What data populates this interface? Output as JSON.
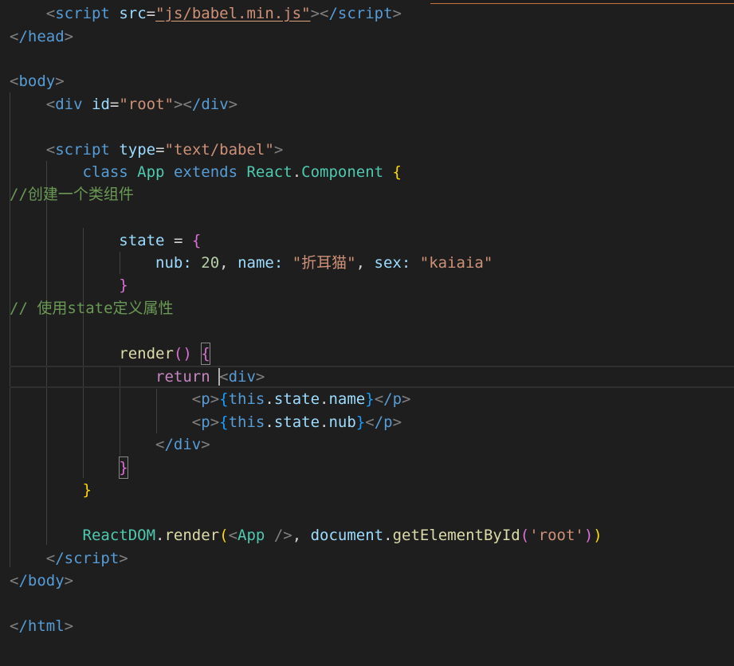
{
  "code": {
    "script_open_tag": "script",
    "src_attr": "src",
    "src_value": "\"js/babel.min.js\"",
    "script_close_tag": "/script",
    "head_close_tag": "/head",
    "body_open_tag": "body",
    "div_tag": "div",
    "id_attr": "id",
    "id_value": "\"root\"",
    "div_close_tag": "/div",
    "type_attr": "type",
    "type_value": "\"text/babel\"",
    "kw_class": "class",
    "class_name": "App",
    "kw_extends": "extends",
    "react_obj": "React",
    "component_cls": "Component",
    "comment_1": "//创建一个类组件",
    "state_var": "state",
    "nub_key": "nub",
    "nub_value": "20",
    "name_key": "name",
    "name_value": "\"折耳猫\"",
    "sex_key": "sex",
    "sex_value": "\"kaiaia\"",
    "comment_2": "// 使用state定义属性",
    "render_fn": "render",
    "kw_return": "return",
    "p_tag": "p",
    "p_close_tag": "/p",
    "kw_this": "this",
    "state_prop": "state",
    "name_prop": "name",
    "nub_prop": "nub",
    "reactdom_obj": "ReactDOM",
    "render_call": "render",
    "app_component": "App",
    "document_obj": "document",
    "get_el_fn": "getElementById",
    "root_arg": "'root'",
    "body_close_tag": "/body",
    "html_close_tag": "/html"
  }
}
